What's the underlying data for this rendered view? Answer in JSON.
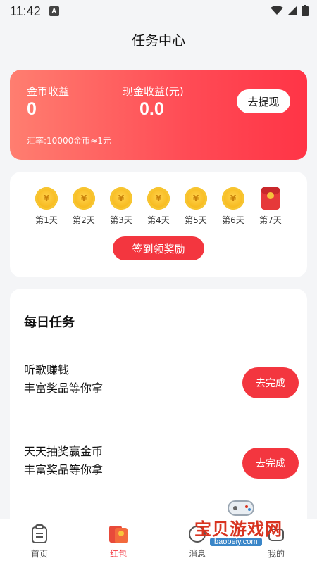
{
  "status_bar": {
    "time": "11:42",
    "notification_icon": "A"
  },
  "page": {
    "title": "任务中心"
  },
  "earnings": {
    "coin_label": "金币收益",
    "coin_value": "0",
    "cash_label": "现金收益(元)",
    "cash_value": "0.0",
    "withdraw_label": "去提现",
    "rate_text": "汇率:10000金币≈1元"
  },
  "signin": {
    "coin_symbol": "¥",
    "days": [
      {
        "label": "第1天",
        "icon": "coin-icon"
      },
      {
        "label": "第2天",
        "icon": "coin-icon"
      },
      {
        "label": "第3天",
        "icon": "coin-icon"
      },
      {
        "label": "第4天",
        "icon": "coin-icon"
      },
      {
        "label": "第5天",
        "icon": "coin-icon"
      },
      {
        "label": "第6天",
        "icon": "coin-icon"
      },
      {
        "label": "第7天",
        "icon": "red-envelope-icon"
      }
    ],
    "button_label": "签到领奖励"
  },
  "daily_tasks": {
    "title": "每日任务",
    "items": [
      {
        "name": "听歌赚钱",
        "desc": "丰富奖品等你拿",
        "button": "去完成"
      },
      {
        "name": "天天抽奖赢金币",
        "desc": "丰富奖品等你拿",
        "button": "去完成"
      }
    ]
  },
  "bottom_nav": {
    "items": [
      {
        "label": "首页",
        "icon": "home-icon"
      },
      {
        "label": "红包",
        "icon": "red-envelope-icon"
      },
      {
        "label": "消息",
        "icon": "message-icon"
      },
      {
        "label": "我的",
        "icon": "profile-icon"
      }
    ]
  },
  "watermark": {
    "text": "宝贝游戏网",
    "url": "baobeiy.com"
  },
  "colors": {
    "accent": "#f3363f",
    "card_gradient_start": "#ff7e70",
    "card_gradient_end": "#ff3446",
    "coin": "#f6b71a"
  }
}
